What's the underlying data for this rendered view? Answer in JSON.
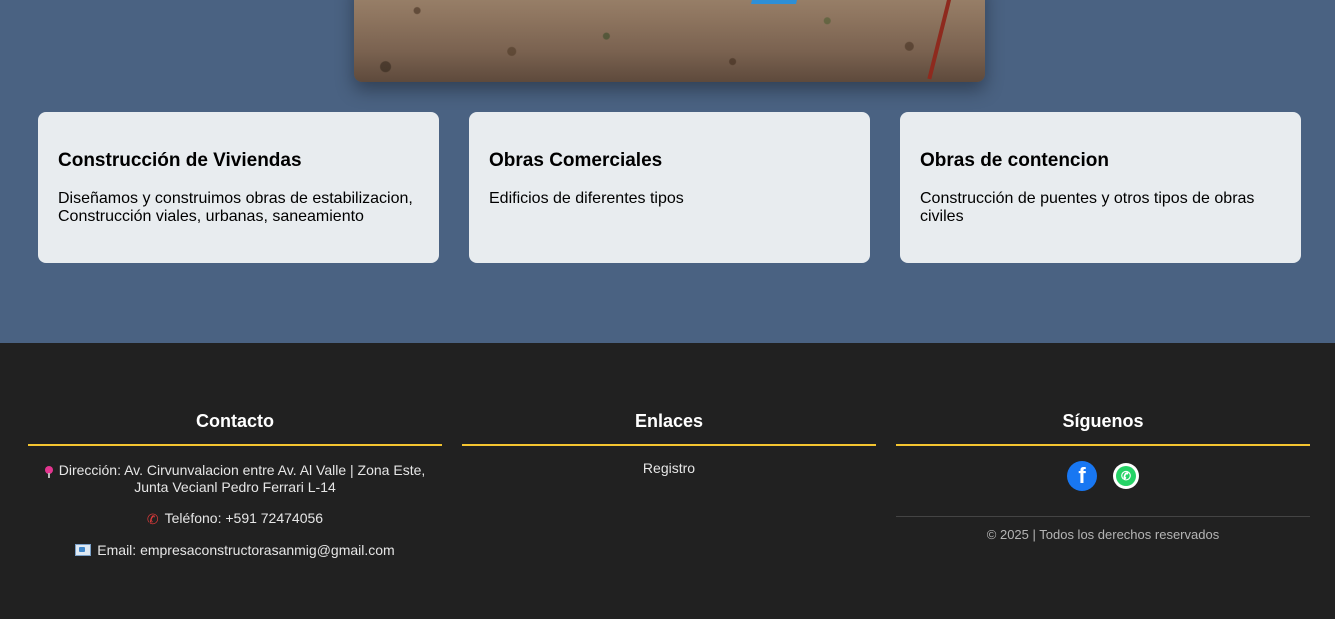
{
  "services": [
    {
      "title": "Construcción de Viviendas",
      "description": "Diseñamos y construimos obras de estabilizacion, Construcción viales, urbanas, saneamiento"
    },
    {
      "title": "Obras Comerciales",
      "description": "Edificios de diferentes tipos"
    },
    {
      "title": "Obras de contencion",
      "description": "Construcción de puentes y otros tipos de obras civiles"
    }
  ],
  "footer": {
    "contact": {
      "heading": "Contacto",
      "address": "Dirección: Av. Cirvunvalacion entre Av. Al Valle | Zona Este, Junta Vecianl Pedro Ferrari L-14",
      "phone": "Teléfono: +591 72474056",
      "email": "Email: empresaconstructorasanmig@gmail.com"
    },
    "links": {
      "heading": "Enlaces",
      "items": [
        "Registro"
      ]
    },
    "social": {
      "heading": "Síguenos",
      "icons": [
        "facebook-icon",
        "whatsapp-icon"
      ],
      "copyright": "© 2025 | Todos los derechos reservados"
    }
  },
  "colors": {
    "page_background": "#4a6282",
    "card_background": "#e8ecef",
    "footer_background": "#212121",
    "accent_underline": "#f4c430",
    "facebook": "#1877f2",
    "whatsapp": "#25d366"
  }
}
